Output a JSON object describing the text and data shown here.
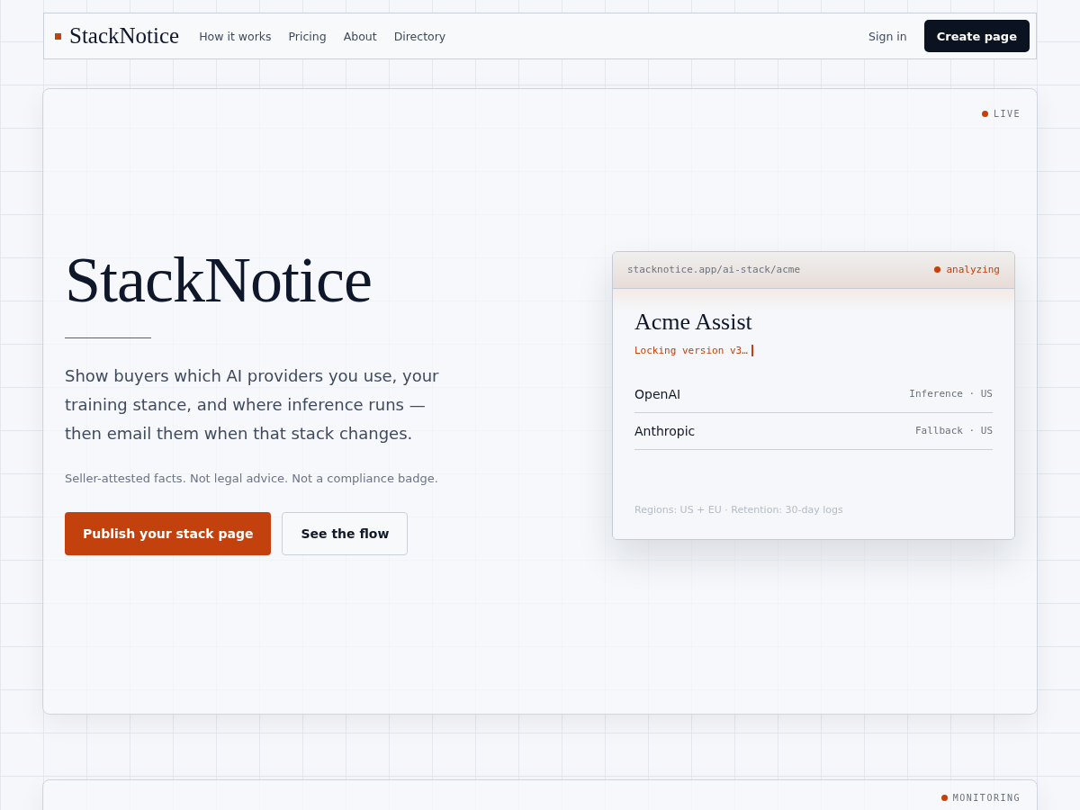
{
  "nav": {
    "brand": "StackNotice",
    "links": [
      "How it works",
      "Pricing",
      "About",
      "Directory"
    ],
    "sign_in": "Sign in",
    "cta": "Create page"
  },
  "hero": {
    "status": "LIVE",
    "title": "StackNotice",
    "lead": "Show buyers which AI providers you use, your training stance, and where inference runs — then email them when that stack changes.",
    "note": "Seller-attested facts. Not legal advice. Not a compliance badge.",
    "primary_button": "Publish your stack page",
    "secondary_button": "See the flow",
    "preview": {
      "url": "stacknotice.app/ai-stack/acme",
      "state": "analyzing",
      "product": "Acme Assist",
      "progress": "Locking version v3…",
      "providers": [
        {
          "name": "OpenAI",
          "detail": "Inference · US"
        },
        {
          "name": "Anthropic",
          "detail": "Fallback · US"
        }
      ],
      "footer": "Regions: US + EU · Retention: 30-day logs"
    }
  },
  "next_section": {
    "status": "MONITORING"
  }
}
